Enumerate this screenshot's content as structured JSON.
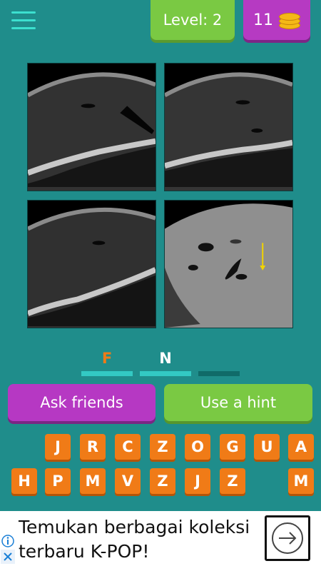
{
  "header": {
    "level_label": "Level: 2",
    "coins": "11"
  },
  "answer": {
    "slots": [
      "F",
      "N",
      ""
    ],
    "colors": {
      "first": "#f07b17",
      "second": "#ffffff",
      "empty_bar": "#106b69",
      "filled_bar": "#33c9c3"
    }
  },
  "actions": {
    "ask_friends": "Ask friends",
    "use_hint": "Use a hint"
  },
  "letters": {
    "row1": [
      "J",
      "R",
      "C",
      "Z",
      "O",
      "G",
      "U",
      "A"
    ],
    "row2": [
      "H",
      "P",
      "M",
      "V",
      "Z",
      "J",
      "Z",
      "",
      "M"
    ]
  },
  "ad": {
    "text_line1": "Temukan berbagai koleksi",
    "text_line2": "terbaru K-POP!"
  },
  "icons": [
    "menu-icon",
    "coins-icon",
    "info-icon",
    "close-icon",
    "arrow-right-icon"
  ],
  "brand_colors": {
    "background": "#1f8d8b",
    "green": "#7ac943",
    "purple": "#b638c3",
    "orange": "#f07b17"
  }
}
